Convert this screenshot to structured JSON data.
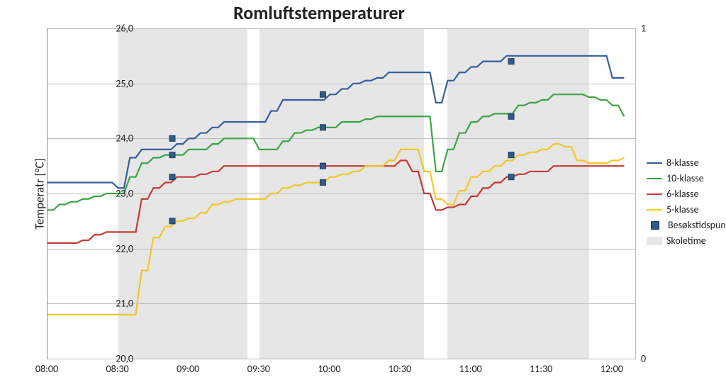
{
  "chart_data": {
    "type": "line",
    "title": "Romluftstemperaturer",
    "xlabel": "",
    "ylabel": "Temperatr [°C]",
    "ylim": [
      20.0,
      26.0
    ],
    "y2lim": [
      0,
      1
    ],
    "x_ticks": [
      "08:00",
      "08:30",
      "09:00",
      "09:30",
      "10:00",
      "10:30",
      "11:00",
      "11:30",
      "12:00"
    ],
    "y_ticks": [
      "20,0",
      "21,0",
      "22,0",
      "23,0",
      "24,0",
      "25,0",
      "26,0"
    ],
    "y2_ticks": [
      "0",
      "1"
    ],
    "x_minutes": [
      0,
      5,
      10,
      15,
      20,
      25,
      30,
      35,
      40,
      45,
      50,
      55,
      60,
      65,
      70,
      75,
      80,
      85,
      90,
      95,
      100,
      105,
      110,
      115,
      120,
      125,
      130,
      135,
      140,
      145,
      150,
      155,
      160,
      165,
      170,
      175,
      180,
      185,
      190,
      195,
      200,
      205,
      210,
      215,
      220,
      225,
      230,
      235,
      240,
      245
    ],
    "series": [
      {
        "name": "8-klasse",
        "color": "#365f9a",
        "values": [
          23.2,
          23.2,
          23.2,
          23.2,
          23.2,
          23.2,
          23.1,
          23.65,
          23.8,
          23.8,
          23.8,
          23.9,
          24.0,
          24.1,
          24.2,
          24.3,
          24.3,
          24.3,
          24.3,
          24.5,
          24.7,
          24.7,
          24.7,
          24.7,
          24.8,
          24.9,
          25.0,
          25.05,
          25.1,
          25.2,
          25.2,
          25.2,
          25.2,
          24.65,
          25.05,
          25.2,
          25.3,
          25.4,
          25.4,
          25.5,
          25.5,
          25.5,
          25.5,
          25.5,
          25.5,
          25.5,
          25.5,
          25.5,
          25.1,
          25.1
        ]
      },
      {
        "name": "10-klasse",
        "color": "#3ca545",
        "values": [
          22.7,
          22.8,
          22.85,
          22.9,
          22.95,
          23.0,
          23.0,
          23.3,
          23.55,
          23.65,
          23.7,
          23.7,
          23.8,
          23.8,
          23.9,
          24.0,
          24.0,
          24.0,
          23.8,
          23.8,
          23.95,
          24.1,
          24.15,
          24.2,
          24.2,
          24.3,
          24.3,
          24.35,
          24.4,
          24.4,
          24.4,
          24.4,
          24.4,
          23.4,
          23.8,
          24.1,
          24.3,
          24.4,
          24.45,
          24.45,
          24.6,
          24.65,
          24.7,
          24.8,
          24.8,
          24.8,
          24.75,
          24.7,
          24.6,
          24.4
        ]
      },
      {
        "name": "6-klasse",
        "color": "#c53a36",
        "values": [
          22.1,
          22.1,
          22.1,
          22.15,
          22.25,
          22.3,
          22.3,
          22.3,
          22.9,
          23.1,
          23.2,
          23.3,
          23.3,
          23.35,
          23.4,
          23.5,
          23.5,
          23.5,
          23.5,
          23.5,
          23.5,
          23.5,
          23.5,
          23.5,
          23.5,
          23.5,
          23.5,
          23.5,
          23.5,
          23.5,
          23.6,
          23.4,
          23.0,
          22.7,
          22.75,
          22.8,
          22.95,
          23.1,
          23.2,
          23.3,
          23.35,
          23.4,
          23.4,
          23.5,
          23.5,
          23.5,
          23.5,
          23.5,
          23.5,
          23.5
        ]
      },
      {
        "name": "5-klasse",
        "color": "#f1c729",
        "values": [
          20.8,
          20.8,
          20.8,
          20.8,
          20.8,
          20.8,
          20.8,
          20.8,
          21.6,
          22.2,
          22.4,
          22.5,
          22.55,
          22.65,
          22.8,
          22.85,
          22.9,
          22.9,
          22.9,
          23.0,
          23.1,
          23.15,
          23.2,
          23.2,
          23.3,
          23.35,
          23.4,
          23.5,
          23.5,
          23.6,
          23.8,
          23.8,
          23.4,
          22.9,
          22.8,
          23.05,
          23.3,
          23.4,
          23.5,
          23.6,
          23.7,
          23.75,
          23.8,
          23.9,
          23.85,
          23.6,
          23.55,
          23.55,
          23.6,
          23.65
        ]
      }
    ],
    "visit_markers": [
      {
        "time": 53,
        "values": {
          "8-klasse": 24.0,
          "10-klasse": 23.7,
          "6-klasse": 23.3,
          "5-klasse": 22.5
        }
      },
      {
        "time": 117,
        "values": {
          "8-klasse": 24.8,
          "10-klasse": 24.2,
          "6-klasse": 23.5,
          "5-klasse": 23.2
        }
      },
      {
        "time": 197,
        "values": {
          "8-klasse": 25.4,
          "10-klasse": 24.4,
          "6-klasse": 23.3,
          "5-klasse": 23.7
        }
      }
    ],
    "school_periods": [
      [
        30,
        85
      ],
      [
        90,
        160
      ],
      [
        170,
        230
      ]
    ],
    "legend": {
      "items": [
        "8-klasse",
        "10-klasse",
        "6-klasse",
        "5-klasse"
      ],
      "marker_label": "Besøkstidspunkt",
      "band_label": "Skoletime"
    }
  }
}
